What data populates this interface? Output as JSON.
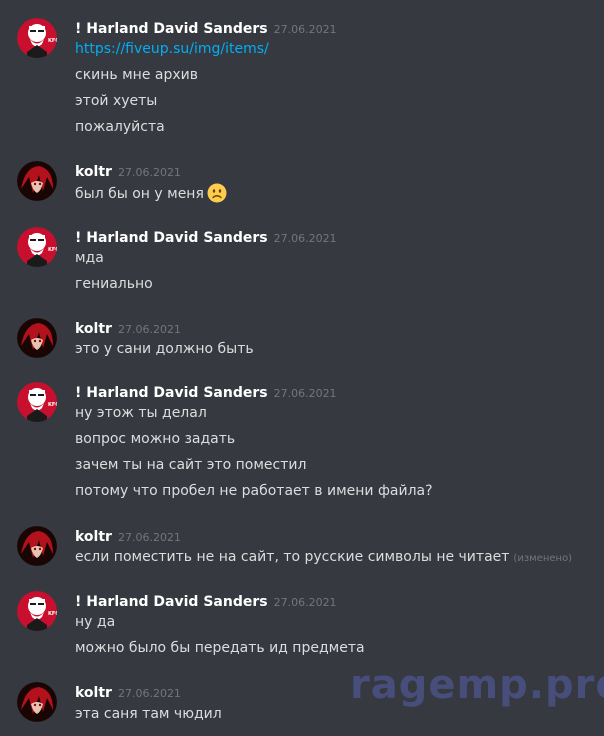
{
  "users": {
    "sanders": {
      "name": "! Harland David Sanders",
      "avatar_icon": "kfc-colonel-avatar-icon"
    },
    "koltr": {
      "name": "koltr",
      "avatar_icon": "red-anime-avatar-icon"
    }
  },
  "groups": [
    {
      "author": "! Harland David Sanders",
      "timestamp": "27.06.2021",
      "messages": [
        {
          "text": "https://fiveup.su/img/items/",
          "is_link": true
        },
        {
          "text": "скинь мне архив"
        },
        {
          "text": "этой хуеты"
        },
        {
          "text": "пожалуйста"
        }
      ]
    },
    {
      "author": "koltr",
      "timestamp": "27.06.2021",
      "messages": [
        {
          "text": "был бы он у меня",
          "emoji": "slightly-frowning-face-emoji"
        }
      ]
    },
    {
      "author": "! Harland David Sanders",
      "timestamp": "27.06.2021",
      "messages": [
        {
          "text": "мда"
        },
        {
          "text": "гениально"
        }
      ]
    },
    {
      "author": "koltr",
      "timestamp": "27.06.2021",
      "messages": [
        {
          "text": "это у сани должно быть"
        }
      ]
    },
    {
      "author": "! Harland David Sanders",
      "timestamp": "27.06.2021",
      "messages": [
        {
          "text": "ну этож ты делал"
        },
        {
          "text": "вопрос можно задать"
        },
        {
          "text": "зачем ты на сайт это поместил"
        },
        {
          "text": "потому что пробел не работает в имени файла?"
        }
      ]
    },
    {
      "author": "koltr",
      "timestamp": "27.06.2021",
      "messages": [
        {
          "text": "если поместить не на сайт, то русские символы не читает",
          "edited": "(изменено)"
        }
      ]
    },
    {
      "author": "! Harland David Sanders",
      "timestamp": "27.06.2021",
      "messages": [
        {
          "text": "ну да"
        },
        {
          "text": "можно было бы передать ид предмета"
        }
      ]
    },
    {
      "author": "koltr",
      "timestamp": "27.06.2021",
      "messages": [
        {
          "text": "эта саня там чюдил"
        }
      ]
    }
  ],
  "watermark": "ragemp.pro",
  "colors": {
    "background": "#36393f",
    "text": "#dcddde",
    "link": "#00aff4",
    "timestamp": "#72767d",
    "username": "#ffffff"
  }
}
